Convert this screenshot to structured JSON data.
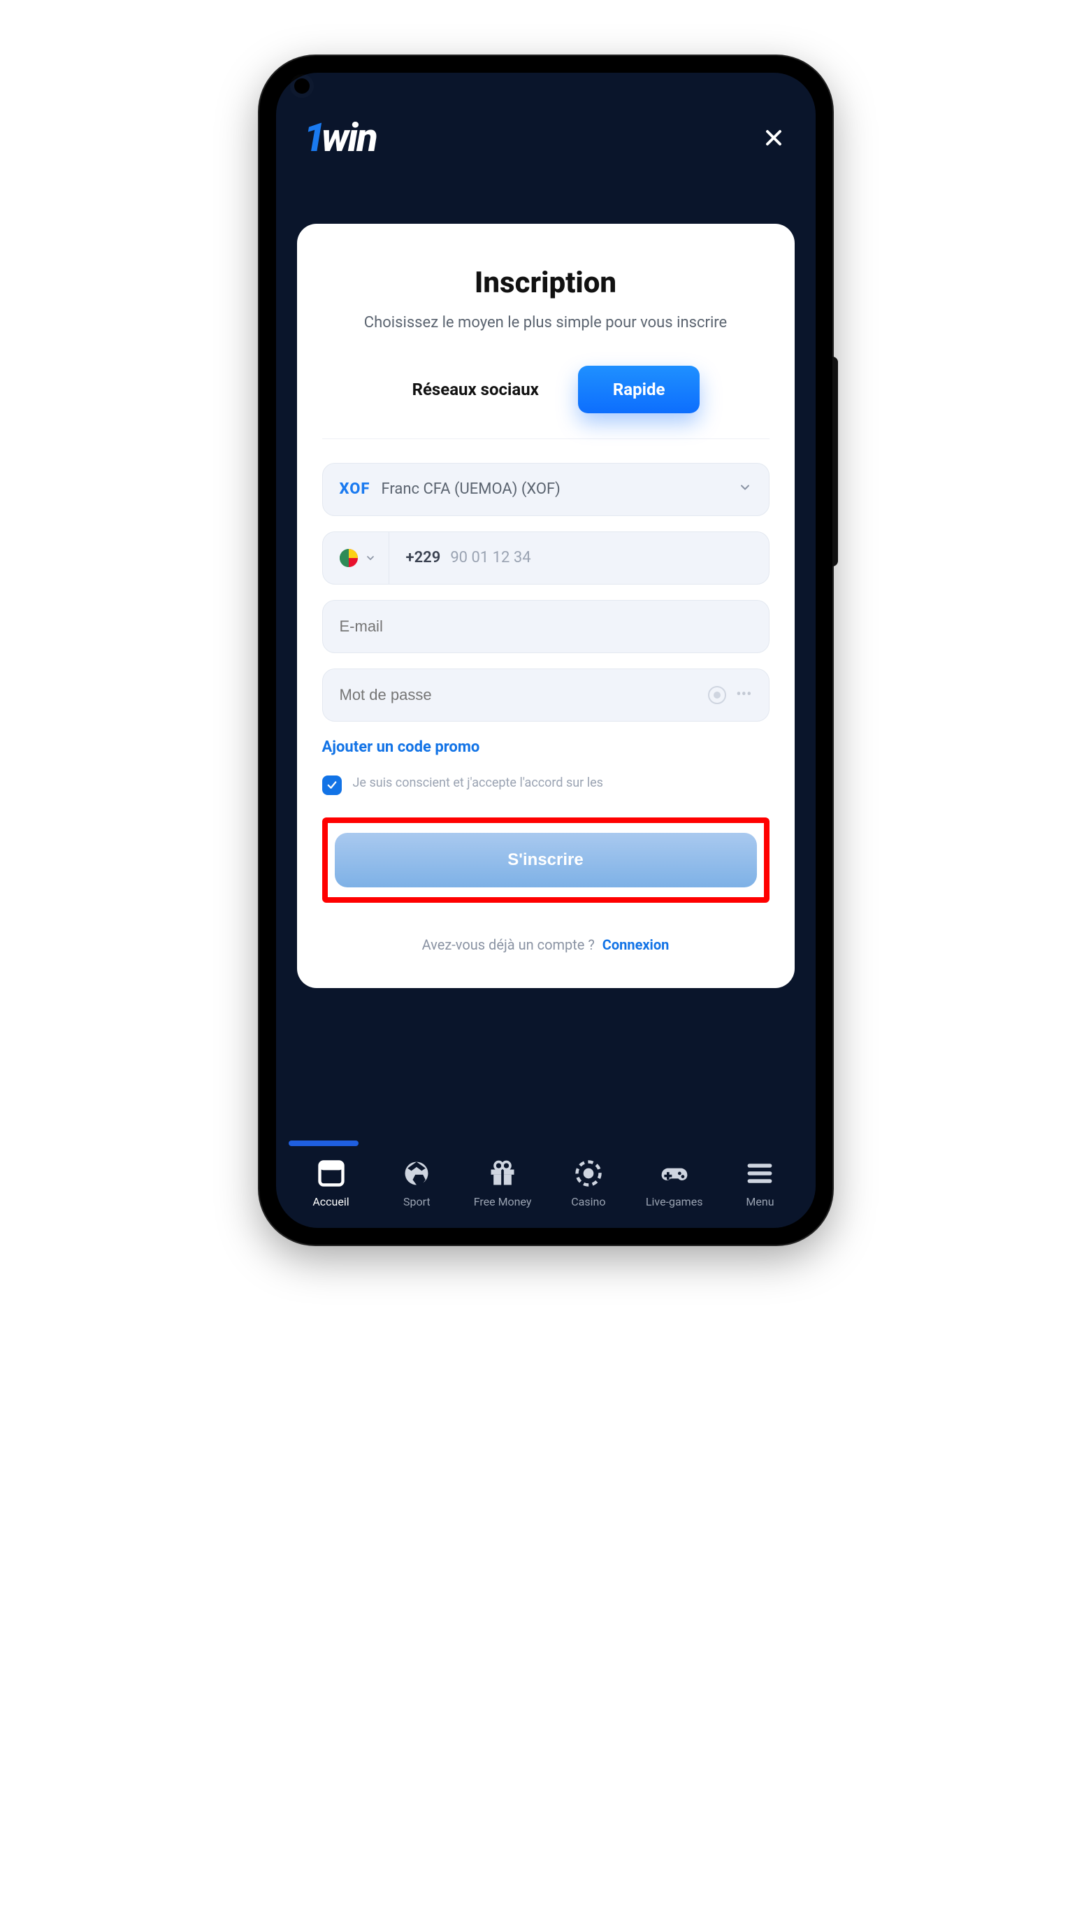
{
  "brand": {
    "prefix": "1",
    "name": "win"
  },
  "card": {
    "title": "Inscription",
    "subtitle": "Choisissez le moyen le plus simple pour vous inscrire"
  },
  "tabs": {
    "social": "Réseaux sociaux",
    "quick": "Rapide"
  },
  "currency": {
    "code": "XOF",
    "label": "Franc CFA (UEMOA) (XOF)"
  },
  "phone": {
    "dial": "+229",
    "placeholder": "90 01 12 34"
  },
  "email": {
    "placeholder": "E-mail"
  },
  "password": {
    "placeholder": "Mot de passe"
  },
  "promo": {
    "label": "Ajouter un code promo"
  },
  "consent": {
    "text": "Je suis conscient et j'accepte l'accord sur les"
  },
  "signup": {
    "label": "S'inscrire"
  },
  "already": {
    "text": "Avez-vous déjà un compte ?",
    "link": "Connexion"
  },
  "nav": {
    "home": "Accueil",
    "sport": "Sport",
    "freemoney": "Free Money",
    "casino": "Casino",
    "live": "Live-games",
    "menu": "Menu"
  }
}
